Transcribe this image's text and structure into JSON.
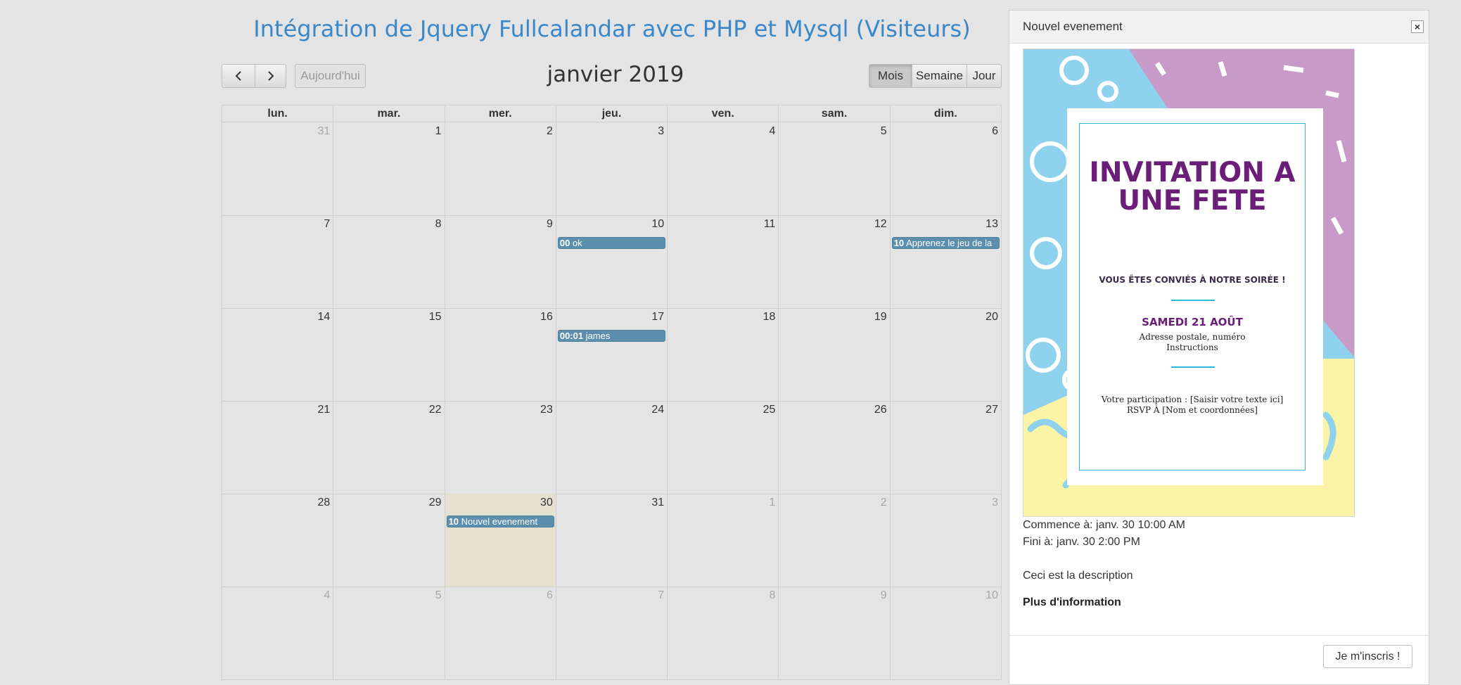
{
  "page": {
    "title": "Intégration de Jquery Fullcalandar avec PHP et Mysql (Visiteurs)"
  },
  "toolbar": {
    "prev_icon": "chevron-left-icon",
    "next_icon": "chevron-right-icon",
    "today_label": "Aujourd'hui",
    "month_title": "janvier 2019",
    "views": {
      "month": "Mois",
      "week": "Semaine",
      "day": "Jour"
    },
    "active_view": "Mois"
  },
  "calendar": {
    "days_of_week": [
      "lun.",
      "mar.",
      "mer.",
      "jeu.",
      "ven.",
      "sam.",
      "dim."
    ],
    "weeks": [
      {
        "days": [
          {
            "num": "31",
            "other": true
          },
          {
            "num": "1"
          },
          {
            "num": "2"
          },
          {
            "num": "3"
          },
          {
            "num": "4"
          },
          {
            "num": "5"
          },
          {
            "num": "6"
          }
        ]
      },
      {
        "days": [
          {
            "num": "7"
          },
          {
            "num": "8"
          },
          {
            "num": "9"
          },
          {
            "num": "10",
            "event": {
              "time": "00",
              "title": "ok"
            }
          },
          {
            "num": "11"
          },
          {
            "num": "12"
          },
          {
            "num": "13",
            "event": {
              "time": "10",
              "title": "Apprenez le jeu de la"
            }
          }
        ]
      },
      {
        "days": [
          {
            "num": "14"
          },
          {
            "num": "15"
          },
          {
            "num": "16"
          },
          {
            "num": "17",
            "event": {
              "time": "00:01",
              "title": "james"
            }
          },
          {
            "num": "18"
          },
          {
            "num": "19"
          },
          {
            "num": "20"
          }
        ]
      },
      {
        "days": [
          {
            "num": "21"
          },
          {
            "num": "22"
          },
          {
            "num": "23"
          },
          {
            "num": "24"
          },
          {
            "num": "25"
          },
          {
            "num": "26"
          },
          {
            "num": "27"
          }
        ]
      },
      {
        "days": [
          {
            "num": "28"
          },
          {
            "num": "29"
          },
          {
            "num": "30",
            "today": true,
            "event": {
              "time": "10",
              "title": "Nouvel evenement"
            }
          },
          {
            "num": "31"
          },
          {
            "num": "1",
            "other": true
          },
          {
            "num": "2",
            "other": true
          },
          {
            "num": "3",
            "other": true
          }
        ]
      },
      {
        "days": [
          {
            "num": "4",
            "other": true
          },
          {
            "num": "5",
            "other": true
          },
          {
            "num": "6",
            "other": true
          },
          {
            "num": "7",
            "other": true
          },
          {
            "num": "8",
            "other": true
          },
          {
            "num": "9",
            "other": true
          },
          {
            "num": "10",
            "other": true
          }
        ]
      }
    ],
    "colors": {
      "event": "#5c8fad",
      "today": "#e4e0d2"
    }
  },
  "modal": {
    "title": "Nouvel evenement",
    "close_icon": "close-icon",
    "invitation": {
      "title": "INVITATION A UNE FETE",
      "subtitle": "VOUS ÊTES CONVIÉS À NOTRE SOIRÉE !",
      "date": "SAMEDI 21 AOÛT",
      "address": "Adresse postale, numéro",
      "instructions": "Instructions",
      "participation": "Votre participation : [Saisir votre texte ici]",
      "rsvp": "RSVP À [Nom et coordonnées]"
    },
    "starts": "Commence à: janv. 30 10:00 AM",
    "ends": "Fini à: janv. 30 2:00 PM",
    "description": "Ceci est la description",
    "more_info": "Plus d'information",
    "subscribe_label": "Je m'inscris !"
  }
}
